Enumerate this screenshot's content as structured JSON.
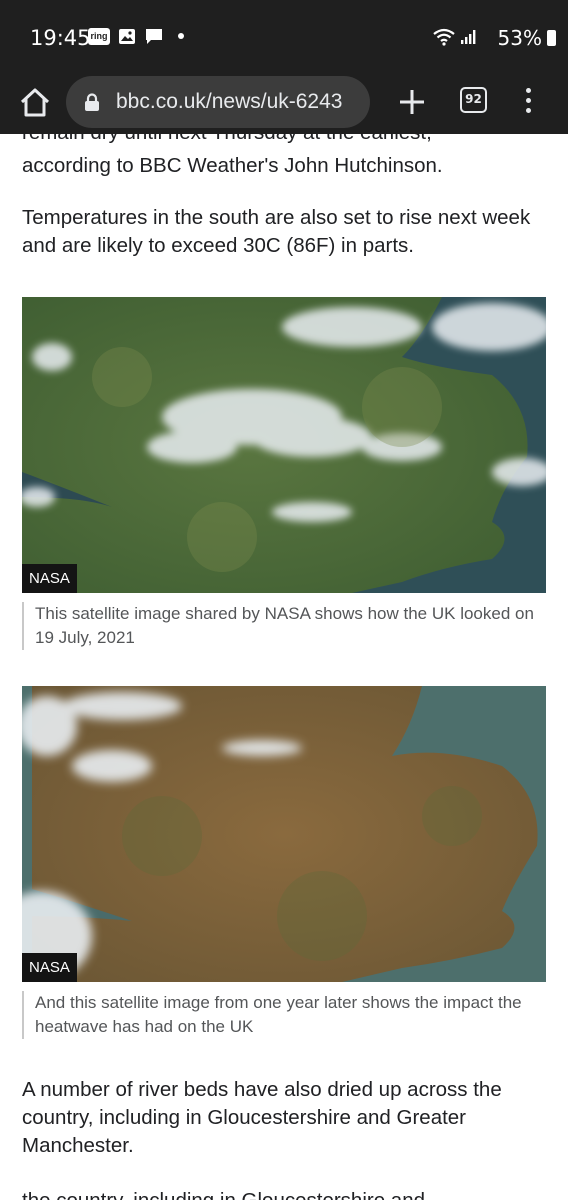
{
  "status_bar": {
    "time": "19:45",
    "ring_badge": "ring",
    "battery": "53%"
  },
  "browser": {
    "url": "bbc.co.uk/news/uk-6243",
    "tab_count": "92"
  },
  "article": {
    "para_top_partial": "remain dry until next Thursday at the earliest,",
    "para_top_line2": "according to BBC Weather's John Hutchinson.",
    "para_temperatures": "Temperatures in the south are also set to rise next week and are likely to exceed 30C (86F) in parts.",
    "figure_1": {
      "credit": "NASA",
      "caption": "This satellite image shared by NASA shows how the UK looked on 19 July, 2021"
    },
    "figure_2": {
      "credit": "NASA",
      "caption": "And this satellite image from one year later shows the impact the heatwave has had on the UK"
    },
    "para_rivers": "A number of river beds have also dried up across the country, including in Gloucestershire and Greater Manchester.",
    "para_bottom_partial": "the country, including in Gloucestershire and"
  },
  "colors": {
    "chrome_bg": "#1f1f1f",
    "url_pill_bg": "#3c3c3c",
    "body_text": "#202124",
    "caption_text": "#545658"
  }
}
